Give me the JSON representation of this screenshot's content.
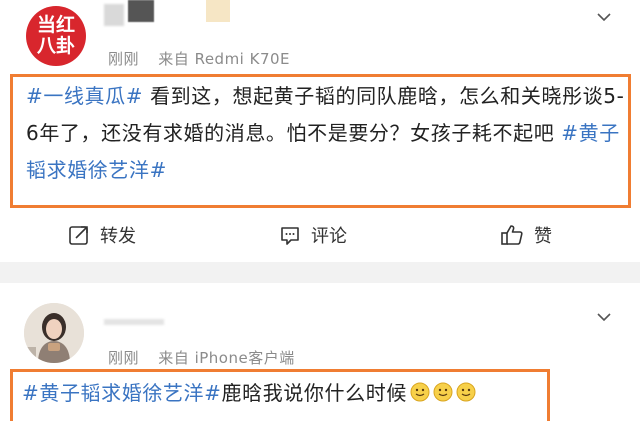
{
  "post1": {
    "avatar_text_line1": "当红",
    "avatar_text_line2": "八卦",
    "time": "刚刚",
    "source": "来自 Redmi K70E",
    "tag_start": "#一线真瓜#",
    "text": "  看到这，想起黄子韬的同队鹿晗，怎么和关晓彤谈5-6年了，还没有求婚的消息。怕不是要分？女孩子耗不起吧  ",
    "tag_end": "#黄子韬求婚徐艺洋#",
    "actions": {
      "repost_label": "转发",
      "comment_label": "评论",
      "like_label": "赞"
    }
  },
  "post2": {
    "time": "刚刚",
    "source": "来自 iPhone客户端",
    "tag": "#黄子韬求婚徐艺洋#",
    "text": "鹿晗我说你什么时候"
  },
  "icons": {
    "repost": "repost-icon",
    "comment": "comment-icon",
    "like": "thumbs-up-icon",
    "more": "chevron-down-icon",
    "emoji": "smile-emoji-icon"
  },
  "colors": {
    "highlight_border": "#f07d32",
    "tag_blue": "#3a74c2",
    "meta_gray": "#8b8b8b",
    "avatar_red": "#d8262d"
  }
}
